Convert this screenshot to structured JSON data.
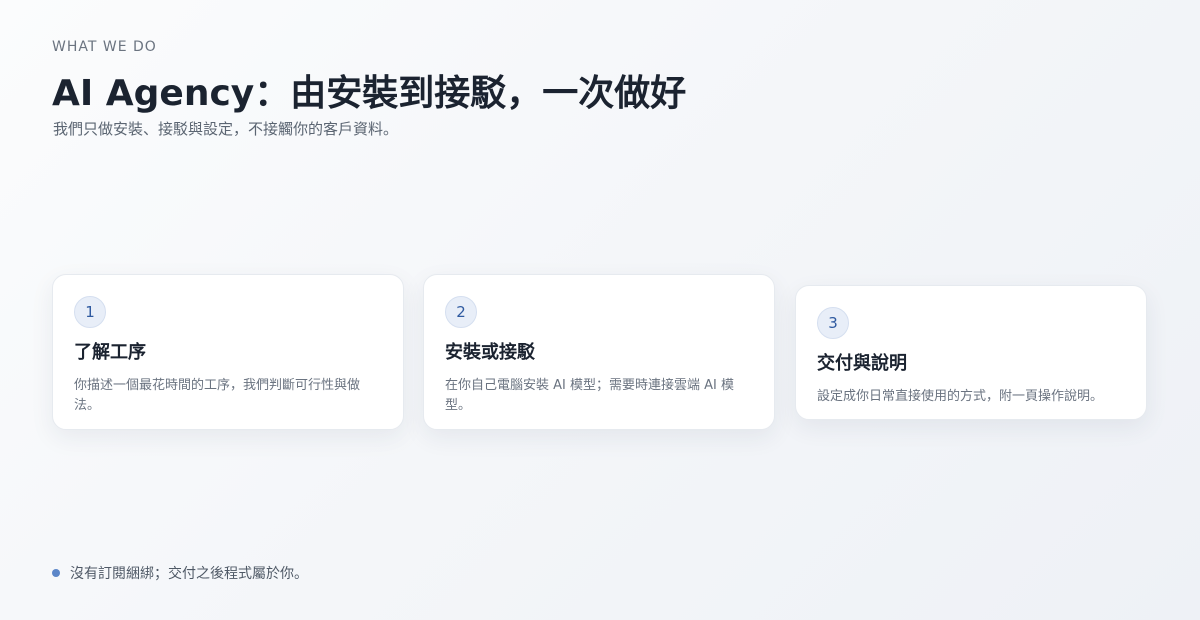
{
  "header": {
    "eyebrow": "WHAT WE DO",
    "title": "AI Agency：由安裝到接駁，一次做好",
    "subtitle": "我們只做安裝、接駁與設定，不接觸你的客戶資料。"
  },
  "steps": [
    {
      "number": "1",
      "title": "了解工序",
      "description": "你描述一個最花時間的工序，我們判斷可行性與做法。"
    },
    {
      "number": "2",
      "title": "安裝或接駁",
      "description": "在你自己電腦安裝 AI 模型；需要時連接雲端 AI 模型。"
    },
    {
      "number": "3",
      "title": "交付與說明",
      "description": "設定成你日常直接使用的方式，附一頁操作說明。"
    }
  ],
  "footnote": {
    "text": "沒有訂閱綑綁；交付之後程式屬於你。"
  },
  "colors": {
    "accent": "#2f5aa0",
    "bullet": "#5b86c8"
  }
}
